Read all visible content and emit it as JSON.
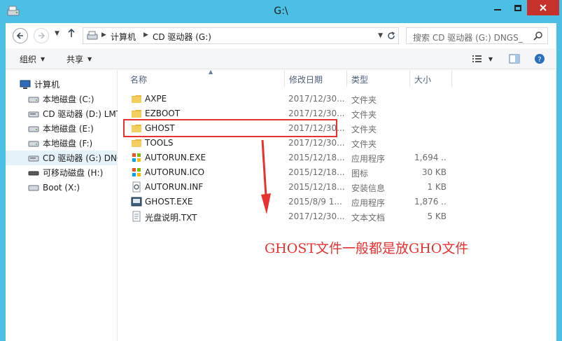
{
  "window": {
    "title": "G:\\",
    "controls": [
      "minimize",
      "maximize",
      "close"
    ]
  },
  "nav": {
    "back_icon": "arrow-left-icon",
    "forward_icon": "arrow-right-icon",
    "up_icon": "arrow-up-icon",
    "breadcrumb": [
      "计算机",
      "CD 驱动器 (G:)"
    ],
    "search_placeholder": "搜索 CD 驱动器 (G:) DNGS_"
  },
  "toolbar": {
    "organize": "组织",
    "share": "共享"
  },
  "sidebar": {
    "root": "计算机",
    "items": [
      {
        "label": "本地磁盘 (C:)",
        "icon": "hard-drive-icon"
      },
      {
        "label": "CD 驱动器 (D:) LMT",
        "icon": "cd-drive-icon"
      },
      {
        "label": "本地磁盘 (E:)",
        "icon": "hard-drive-icon"
      },
      {
        "label": "本地磁盘 (F:)",
        "icon": "hard-drive-icon"
      },
      {
        "label": "CD 驱动器 (G:) DNG",
        "icon": "cd-drive-icon",
        "selected": true
      },
      {
        "label": "可移动磁盘 (H:)",
        "icon": "removable-drive-icon"
      },
      {
        "label": "Boot (X:)",
        "icon": "drive-icon"
      }
    ]
  },
  "columns": {
    "name": "名称",
    "date": "修改日期",
    "type": "类型",
    "size": "大小"
  },
  "files": [
    {
      "name": "AXPE",
      "date": "2017/12/30...",
      "type": "文件夹",
      "size": "",
      "icon": "folder-icon"
    },
    {
      "name": "EZBOOT",
      "date": "2017/12/30...",
      "type": "文件夹",
      "size": "",
      "icon": "folder-icon"
    },
    {
      "name": "GHOST",
      "date": "2017/12/30...",
      "type": "文件夹",
      "size": "",
      "icon": "folder-icon"
    },
    {
      "name": "TOOLS",
      "date": "2017/12/30...",
      "type": "文件夹",
      "size": "",
      "icon": "folder-icon"
    },
    {
      "name": "AUTORUN.EXE",
      "date": "2015/12/18...",
      "type": "应用程序",
      "size": "1,694 ...",
      "icon": "exe-icon"
    },
    {
      "name": "AUTORUN.ICO",
      "date": "2015/12/18...",
      "type": "图标",
      "size": "30 KB",
      "icon": "ico-file-icon"
    },
    {
      "name": "AUTORUN.INF",
      "date": "2015/12/18...",
      "type": "安装信息",
      "size": "1 KB",
      "icon": "inf-file-icon"
    },
    {
      "name": "GHOST.EXE",
      "date": "2015/8/9 1...",
      "type": "应用程序",
      "size": "1,876 ...",
      "icon": "ghost-exe-icon"
    },
    {
      "name": "光盘说明.TXT",
      "date": "2017/12/30...",
      "type": "文本文档",
      "size": "5 KB",
      "icon": "text-file-icon"
    }
  ],
  "annotation": {
    "text": "GHOST文件一般都是放GHO文件",
    "color": "#e8322f"
  },
  "colors": {
    "titlebar": "#4bc0e4",
    "close_button": "#c7312c",
    "selection": "#e5f3fb",
    "folder": "#e8b73c"
  }
}
